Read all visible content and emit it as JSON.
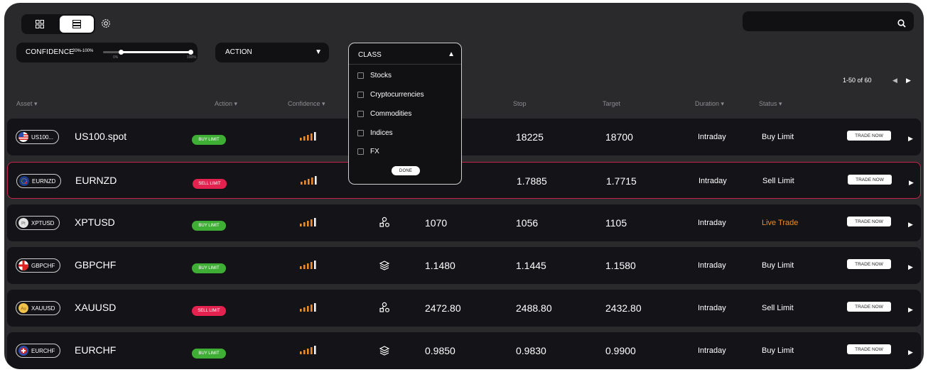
{
  "toolbar": {
    "views": [
      "grid-view",
      "list-view"
    ],
    "active_view": "list-view"
  },
  "filters": {
    "confidence": {
      "label": "CONFIDENCE",
      "range": "20%-100%",
      "min_label": "0%",
      "max_label": "100%",
      "low": 0.2,
      "high": 1.0
    },
    "action": {
      "label": "ACTION"
    },
    "class": {
      "label": "CLASS",
      "options": [
        "Stocks",
        "Cryptocurrencies",
        "Commodities",
        "Indices",
        "FX"
      ],
      "done": "DONE"
    }
  },
  "pagination": {
    "text": "1-50 of 60"
  },
  "headers": {
    "asset": "Asset ▾",
    "action": "Action ▾",
    "confidence": "Confidence ▾",
    "stop": "Stop",
    "target": "Target",
    "duration": "Duration ▾",
    "status": "Status ▾"
  },
  "trade_label": "TRADE NOW",
  "rows": [
    {
      "ticker": "US100...",
      "name": "US100.spot",
      "action": "BUY LIMIT",
      "action_color": "#3fae35",
      "confidence_level": 4,
      "class_icon": "",
      "entry": "",
      "stop": "18225",
      "target": "18700",
      "duration": "Intraday",
      "status": "Buy Limit",
      "status_color": "#ffffff",
      "selected": false
    },
    {
      "ticker": "EURNZD",
      "name": "EURNZD",
      "action": "SELL LIMIT",
      "action_color": "#e3224f",
      "confidence_level": 4,
      "class_icon": "",
      "entry": "",
      "stop": "1.7885",
      "target": "1.7715",
      "duration": "Intraday",
      "status": "Sell Limit",
      "status_color": "#ffffff",
      "selected": true
    },
    {
      "ticker": "XPTUSD",
      "name": "XPTUSD",
      "action": "BUY LIMIT",
      "action_color": "#3fae35",
      "confidence_level": 4,
      "class_icon": "commodities-icon",
      "entry": "1070",
      "stop": "1056",
      "target": "1105",
      "duration": "Intraday",
      "status": "Live Trade",
      "status_color": "#f08a24",
      "selected": false
    },
    {
      "ticker": "GBPCHF",
      "name": "GBPCHF",
      "action": "BUY LIMIT",
      "action_color": "#3fae35",
      "confidence_level": 4,
      "class_icon": "fx-icon",
      "entry": "1.1480",
      "stop": "1.1445",
      "target": "1.1580",
      "duration": "Intraday",
      "status": "Buy Limit",
      "status_color": "#ffffff",
      "selected": false
    },
    {
      "ticker": "XAUUSD",
      "name": "XAUUSD",
      "action": "SELL LIMIT",
      "action_color": "#e3224f",
      "confidence_level": 4,
      "class_icon": "commodities-icon",
      "entry": "2472.80",
      "stop": "2488.80",
      "target": "2432.80",
      "duration": "Intraday",
      "status": "Sell Limit",
      "status_color": "#ffffff",
      "selected": false
    },
    {
      "ticker": "EURCHF",
      "name": "EURCHF",
      "action": "BUY LIMIT",
      "action_color": "#3fae35",
      "confidence_level": 4,
      "class_icon": "fx-icon",
      "entry": "0.9850",
      "stop": "0.9830",
      "target": "0.9900",
      "duration": "Intraday",
      "status": "Buy Limit",
      "status_color": "#ffffff",
      "selected": false
    }
  ]
}
